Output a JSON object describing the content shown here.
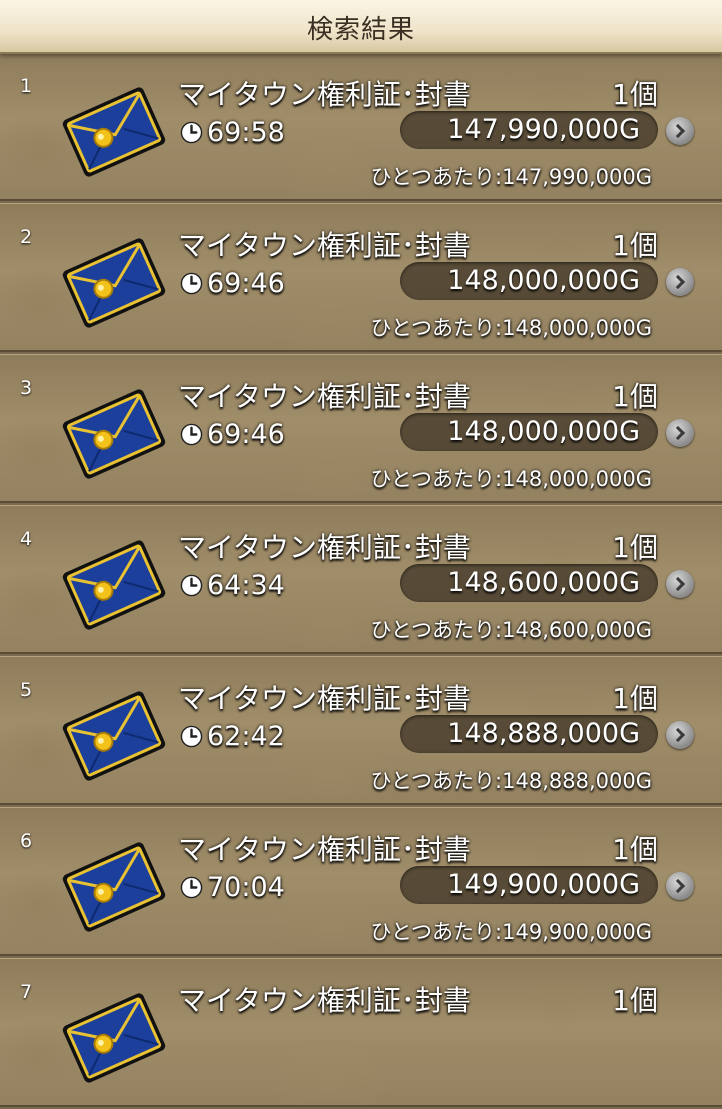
{
  "header": {
    "title": "検索結果"
  },
  "icons": {
    "item": "sealed-letter-icon",
    "time": "clock-icon",
    "detail": "chevron-right-icon"
  },
  "colors": {
    "envelope": "#1b3f9a",
    "seal": "#f2c21a",
    "trim": "#e8c233",
    "pill": "#3c3224"
  },
  "rows": [
    {
      "index": "1",
      "name": "マイタウン権利証･封書",
      "qty": "1個",
      "time": "69:58",
      "price": "147,990,000G",
      "unit": "ひとつあたり:147,990,000G"
    },
    {
      "index": "2",
      "name": "マイタウン権利証･封書",
      "qty": "1個",
      "time": "69:46",
      "price": "148,000,000G",
      "unit": "ひとつあたり:148,000,000G"
    },
    {
      "index": "3",
      "name": "マイタウン権利証･封書",
      "qty": "1個",
      "time": "69:46",
      "price": "148,000,000G",
      "unit": "ひとつあたり:148,000,000G"
    },
    {
      "index": "4",
      "name": "マイタウン権利証･封書",
      "qty": "1個",
      "time": "64:34",
      "price": "148,600,000G",
      "unit": "ひとつあたり:148,600,000G"
    },
    {
      "index": "5",
      "name": "マイタウン権利証･封書",
      "qty": "1個",
      "time": "62:42",
      "price": "148,888,000G",
      "unit": "ひとつあたり:148,888,000G"
    },
    {
      "index": "6",
      "name": "マイタウン権利証･封書",
      "qty": "1個",
      "time": "70:04",
      "price": "149,900,000G",
      "unit": "ひとつあたり:149,900,000G"
    },
    {
      "index": "7",
      "name": "マイタウン権利証･封書",
      "qty": "1個"
    }
  ]
}
